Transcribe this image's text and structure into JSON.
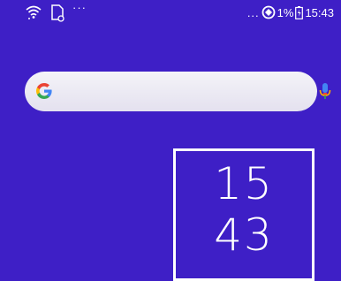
{
  "colors": {
    "wallpaper": "#3e1fc6",
    "search_bar": "#ecebf4",
    "google_blue": "#4285F4",
    "google_red": "#EA4335",
    "google_yellow": "#FBBC05",
    "google_green": "#34A853",
    "mic_red": "#E53935"
  },
  "status_bar": {
    "left_icons": [
      "wifi-icon",
      "sim-card-icon"
    ],
    "left_more": "···",
    "right_more": "...",
    "data_saver_icon": "data-saver-icon",
    "battery_percent": "1%",
    "battery_icon": "battery-icon",
    "time": "15:43"
  },
  "search_widget": {
    "logo": "google-g-icon",
    "mic": "microphone-icon"
  },
  "clock_widget": {
    "hours": "15",
    "minutes": "43"
  }
}
